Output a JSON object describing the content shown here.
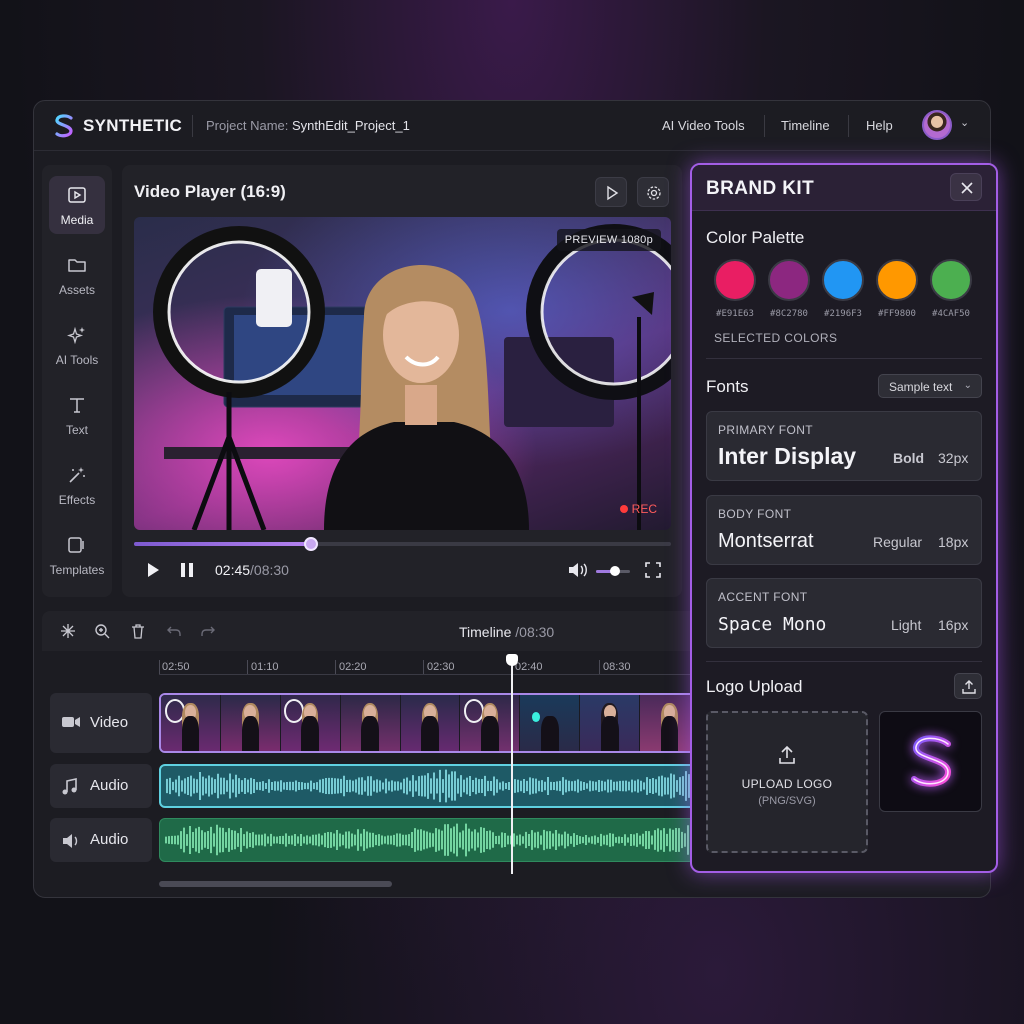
{
  "app": {
    "brand": "SYNTHETIC",
    "project_label": "Project Name:",
    "project_name": "SynthEdit_Project_1"
  },
  "nav": {
    "ai_tools": "AI Video Tools",
    "timeline": "Timeline",
    "help": "Help"
  },
  "rail": {
    "items": [
      {
        "label": "Media",
        "icon": "media-icon",
        "active": true
      },
      {
        "label": "Assets",
        "icon": "folder-icon"
      },
      {
        "label": "AI Tools",
        "icon": "sparkle-icon"
      },
      {
        "label": "Text",
        "icon": "text-icon"
      },
      {
        "label": "Effects",
        "icon": "magic-wand-icon"
      },
      {
        "label": "Templates",
        "icon": "templates-icon"
      }
    ]
  },
  "player": {
    "title": "Video Player (16:9)",
    "preview_badge": "PREVIEW 1080p",
    "rec": "REC",
    "current_time": "02:45",
    "total_time": "/08:30",
    "progress": 0.33,
    "volume": 0.55
  },
  "timeline": {
    "title": "Timeline",
    "duration": " /08:30",
    "ticks": [
      "02:50",
      "01:10",
      "02:20",
      "02:30",
      "02:40",
      "08:30"
    ],
    "tracks": [
      {
        "label": "Video",
        "icon": "video-camera-icon"
      },
      {
        "label": "Audio",
        "icon": "music-note-icon"
      },
      {
        "label": "Audio",
        "icon": "speaker-icon"
      }
    ]
  },
  "brand_kit": {
    "title": "BRAND KIT",
    "color_palette_title": "Color Palette",
    "colors": [
      {
        "hex": "#E91E63",
        "label": "#E91E63"
      },
      {
        "hex": "#8C2780",
        "label": "#8C2780"
      },
      {
        "hex": "#2196F3",
        "label": "#2196F3"
      },
      {
        "hex": "#FF9800",
        "label": "#FF9800"
      },
      {
        "hex": "#4CAF50",
        "label": "#4CAF50"
      }
    ],
    "selected_colors": "SELECTED COLORS",
    "fonts_title": "Fonts",
    "sample_select": "Sample text",
    "fonts": [
      {
        "label": "PRIMARY FONT",
        "name": "Inter Display",
        "weight": "Bold",
        "size": "32px"
      },
      {
        "label": "BODY FONT",
        "name": "Montserrat",
        "weight": "Regular",
        "size": "18px"
      },
      {
        "label": "ACCENT FONT",
        "name": "Space Mono",
        "weight": "Light",
        "size": "16px"
      }
    ],
    "logo_upload_title": "Logo Upload",
    "upload_title": "UPLOAD LOGO",
    "upload_sub": "(PNG/SVG)"
  }
}
